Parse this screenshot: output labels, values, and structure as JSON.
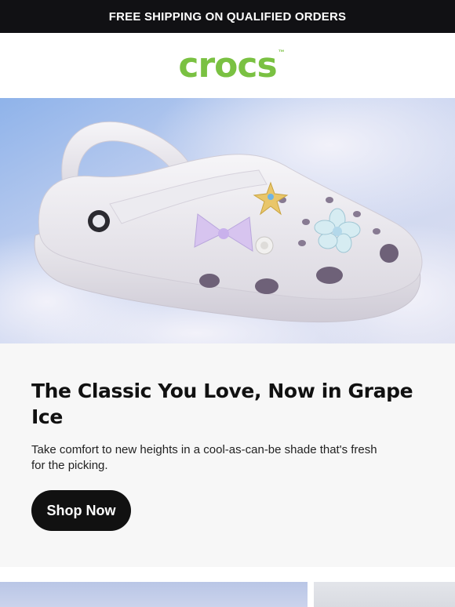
{
  "announcement": {
    "text": "FREE SHIPPING ON QUALIFIED ORDERS"
  },
  "brand": {
    "logo_text": "crocs",
    "trademark": "™",
    "color": "#7ac142"
  },
  "hero": {
    "alt_icon": "white-clog-with-charms-image"
  },
  "promo": {
    "headline": "The Classic You Love, Now in Grape Ice",
    "body": "Take comfort to new heights in a cool-as-can-be shade that's fresh for the picking.",
    "cta_label": "Shop Now"
  },
  "colors": {
    "topbar_bg": "#111114",
    "content_bg": "#f7f7f7",
    "cta_bg": "#111111"
  }
}
